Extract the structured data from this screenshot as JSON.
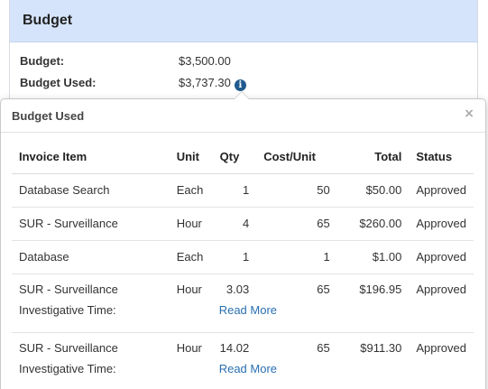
{
  "panel": {
    "title": "Budget",
    "budget_label": "Budget:",
    "budget_value": "$3,500.00",
    "budget_used_label": "Budget Used:",
    "budget_used_value": "$3,737.30",
    "info_icon": "info-icon"
  },
  "popover": {
    "title": "Budget Used",
    "close_label": "×",
    "columns": [
      "Invoice Item",
      "Unit",
      "Qty",
      "Cost/Unit",
      "Total",
      "Status"
    ],
    "rows": [
      {
        "item": "Database Search",
        "unit": "Each",
        "qty": "1",
        "cost": "50",
        "total": "$50.00",
        "status": "Approved"
      },
      {
        "item": "SUR - Surveillance",
        "unit": "Hour",
        "qty": "4",
        "cost": "65",
        "total": "$260.00",
        "status": "Approved"
      },
      {
        "item": "Database",
        "unit": "Each",
        "qty": "1",
        "cost": "1",
        "total": "$1.00",
        "status": "Approved"
      },
      {
        "item": "SUR - Surveillance",
        "unit": "Hour",
        "qty": "3.03",
        "cost": "65",
        "total": "$196.95",
        "status": "Approved",
        "note_label": "Investigative Time:",
        "note_link": "Read More"
      },
      {
        "item": "SUR - Surveillance",
        "unit": "Hour",
        "qty": "14.02",
        "cost": "65",
        "total": "$911.30",
        "status": "Approved",
        "note_label": "Investigative Time:",
        "note_link": "Read More"
      }
    ]
  }
}
